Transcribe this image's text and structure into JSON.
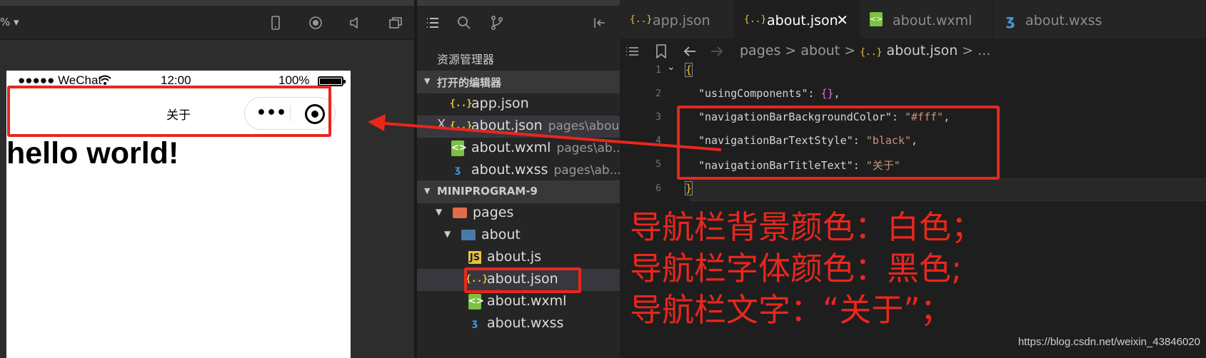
{
  "simulator": {
    "zoom": "% ▾",
    "status_bar": {
      "signal": "●●●●● WeChat",
      "time": "12:00",
      "battery": "100%"
    },
    "nav_bar": {
      "title": "关于",
      "more": "•••"
    },
    "content": {
      "heading": "hello world!"
    }
  },
  "explorer": {
    "title": "资源管理器",
    "open_editors": {
      "label": "打开的编辑器",
      "items": [
        {
          "name": "app.json",
          "path": "",
          "icon": "json"
        },
        {
          "name": "about.json",
          "path": "pages\\about",
          "icon": "json",
          "close": "X"
        },
        {
          "name": "about.wxml",
          "path": "pages\\ab...",
          "icon": "wxml"
        },
        {
          "name": "about.wxss",
          "path": "pages\\ab...",
          "icon": "wxss"
        }
      ]
    },
    "project": {
      "label": "MINIPROGRAM-9",
      "tree": [
        {
          "name": "pages",
          "icon": "folder-red"
        },
        {
          "name": "about",
          "icon": "folder"
        },
        {
          "name": "about.js",
          "icon": "js"
        },
        {
          "name": "about.json",
          "icon": "json"
        },
        {
          "name": "about.wxml",
          "icon": "wxml"
        },
        {
          "name": "about.wxss",
          "icon": "wxss"
        }
      ]
    }
  },
  "editor": {
    "tabs": [
      {
        "label": "app.json",
        "icon": "json"
      },
      {
        "label": "about.json",
        "icon": "json",
        "close": "✕"
      },
      {
        "label": "about.wxml",
        "icon": "wxml"
      },
      {
        "label": "about.wxss",
        "icon": "wxss"
      }
    ],
    "breadcrumb": {
      "parts": [
        "pages",
        "about"
      ],
      "file": "about.json",
      "more": "..."
    },
    "lines": [
      {
        "num": "1",
        "open": "{"
      },
      {
        "num": "2",
        "key": "\"usingComponents\"",
        "sep": ": ",
        "val": "{}",
        "end": ","
      },
      {
        "num": "3",
        "key": "\"navigationBarBackgroundColor\"",
        "sep": ": ",
        "val": "\"#fff\"",
        "end": ","
      },
      {
        "num": "4",
        "key": "\"navigationBarTextStyle\"",
        "sep": ": ",
        "val": "\"black\"",
        "end": ","
      },
      {
        "num": "5",
        "key": "\"navigationBarTitleText\"",
        "sep": ": ",
        "val": "\"关于\"",
        "end": ""
      },
      {
        "num": "6",
        "close": "}"
      }
    ],
    "annotations": [
      "导航栏背景颜色：白色；",
      "导航栏字体颜色：黑色;",
      "导航栏文字：“关于”；"
    ],
    "watermark": "https://blog.csdn.net/weixin_43846020"
  },
  "colors": {
    "annotation_red": "#e8271d",
    "json_icon": "#e8c43a",
    "wxml_icon": "#7cc142",
    "wxss_icon": "#3f9cdb"
  }
}
